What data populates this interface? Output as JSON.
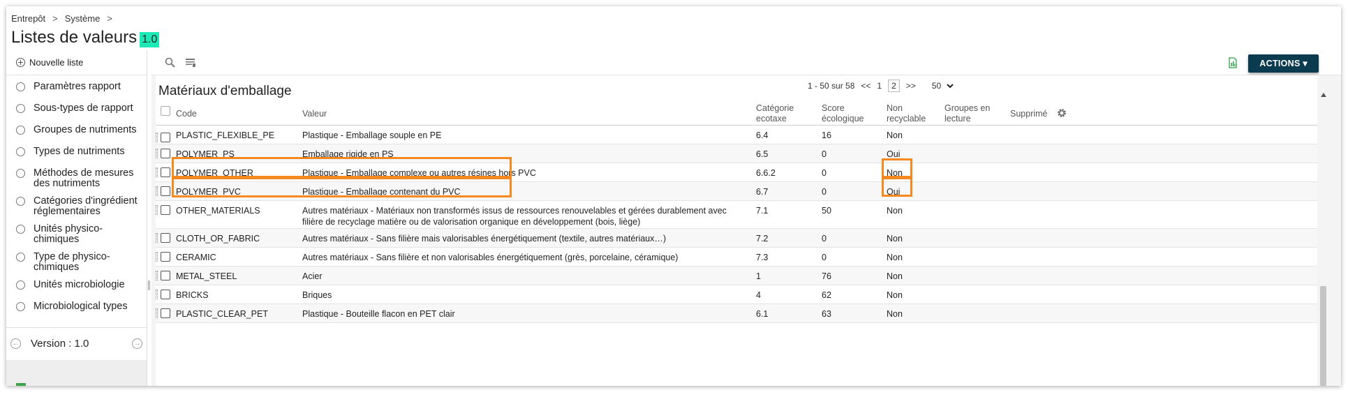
{
  "breadcrumb": [
    {
      "label": "Entrepôt"
    },
    {
      "label": "Système"
    }
  ],
  "breadcrumb_sep": ">",
  "page": {
    "title": "Listes de valeurs",
    "version_badge": "1.0"
  },
  "sidebar": {
    "new_list_label": "Nouvelle liste",
    "items": [
      {
        "label": "Paramètres rapport"
      },
      {
        "label": "Sous-types de rapport"
      },
      {
        "label": "Groupes de nutriments"
      },
      {
        "label": "Types de nutriments"
      },
      {
        "label": "Méthodes de mesures des nutriments"
      },
      {
        "label": "Catégories d'ingrédient réglementaires"
      },
      {
        "label": "Unités physico-chimiques"
      },
      {
        "label": "Type de physico-chimiques"
      },
      {
        "label": "Unités microbiologie"
      },
      {
        "label": "Microbiological types"
      }
    ],
    "version_label": "Version : 1.0"
  },
  "toolbar": {
    "icons": [
      "search-icon",
      "column-settings-icon",
      "export-excel-icon"
    ],
    "actions_label": "ACTIONS ▾"
  },
  "list": {
    "title": "Matériaux d'emballage",
    "pager": {
      "range": "1 - 50 sur 58",
      "first": "<<",
      "pages": [
        "1",
        "2"
      ],
      "current_page": "2",
      "next": ">>",
      "page_size": "50"
    },
    "columns": {
      "code": "Code",
      "value": "Valeur",
      "ecotax": "Catégorie ecotaxe",
      "score": "Score écologique",
      "non_recyclable": "Non recyclable",
      "read_groups": "Groupes en lecture",
      "deleted": "Supprimé"
    },
    "rows": [
      {
        "code": "PLASTIC_FLEXIBLE_PE",
        "value": "Plastique - Emballage souple en PE",
        "ecotax": "6.4",
        "score": "16",
        "non_recyclable": "Non"
      },
      {
        "code": "POLYMER_PS",
        "value": "Emballage rigide en PS",
        "ecotax": "6.5",
        "score": "0",
        "non_recyclable": "Oui"
      },
      {
        "code": "POLYMER_OTHER",
        "value": "Plastique - Emballage complexe ou autres résines hors PVC",
        "ecotax": "6.6.2",
        "score": "0",
        "non_recyclable": "Non"
      },
      {
        "code": "POLYMER_PVC",
        "value": "Plastique - Emballage contenant du PVC",
        "ecotax": "6.7",
        "score": "0",
        "non_recyclable": "Oui"
      },
      {
        "code": "OTHER_MATERIALS",
        "value": "Autres matériaux - Matériaux non transformés issus de ressources renouvelables et gérées durablement avec filière de recyclage matière ou de valorisation organique en développement (bois, liège)",
        "ecotax": "7.1",
        "score": "50",
        "non_recyclable": "Non"
      },
      {
        "code": "CLOTH_OR_FABRIC",
        "value": "Autres matériaux - Sans filière mais valorisables énergétiquement (textile, autres matériaux…)",
        "ecotax": "7.2",
        "score": "0",
        "non_recyclable": "Non"
      },
      {
        "code": "CERAMIC",
        "value": "Autres matériaux - Sans filière et non valorisables énergétiquement (grès, porcelaine, céramique)",
        "ecotax": "7.3",
        "score": "0",
        "non_recyclable": "Non"
      },
      {
        "code": "METAL_STEEL",
        "value": "Acier",
        "ecotax": "1",
        "score": "76",
        "non_recyclable": "Non"
      },
      {
        "code": "BRICKS",
        "value": "Briques",
        "ecotax": "4",
        "score": "62",
        "non_recyclable": "Non"
      },
      {
        "code": "PLASTIC_CLEAR_PET",
        "value": "Plastique - Bouteille flacon en PET clair",
        "ecotax": "6.1",
        "score": "63",
        "non_recyclable": "Non"
      }
    ]
  },
  "colors": {
    "accent": "#0b3b4f",
    "badge": "#1de9b6",
    "highlight": "#f5891f"
  }
}
